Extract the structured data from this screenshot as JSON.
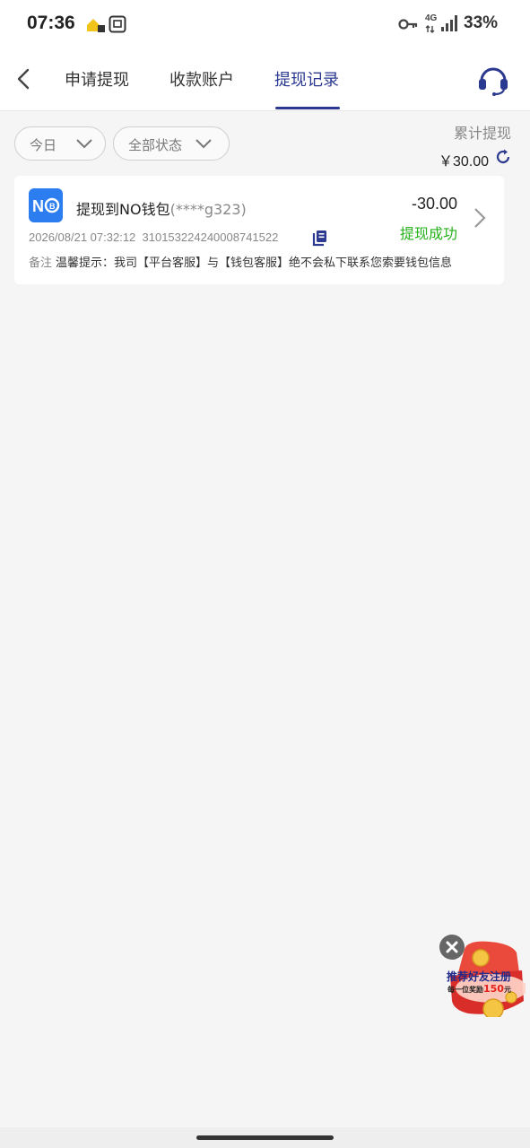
{
  "status_bar": {
    "time": "07:36",
    "network": "4G",
    "battery": "33%"
  },
  "header": {
    "tabs": [
      {
        "label": "申请提现"
      },
      {
        "label": "收款账户"
      },
      {
        "label": "提现记录"
      }
    ],
    "active_tab": 2,
    "accent_color": "#2b3990"
  },
  "filters": {
    "date": {
      "label": "今日"
    },
    "status": {
      "label": "全部状态"
    }
  },
  "summary": {
    "label": "累计提现",
    "amount": "￥30.00"
  },
  "records": [
    {
      "logo_text": "NO",
      "title": "提现到NO钱包",
      "account_masked": "(****g323)",
      "amount": "-30.00",
      "status": "提现成功",
      "status_color": "#26b11b",
      "datetime": "2026/08/21 07:32:12",
      "order_id": "310153224240008741522",
      "note_label": "备注",
      "note_text": "温馨提示：我司【平台客服】与【钱包客服】绝不会私下联系您索要钱包信息"
    }
  ],
  "promo": {
    "line1": "推荐好友注册",
    "line2_prefix": "每一位奖励",
    "line2_amount": "150",
    "line2_suffix": "元"
  }
}
